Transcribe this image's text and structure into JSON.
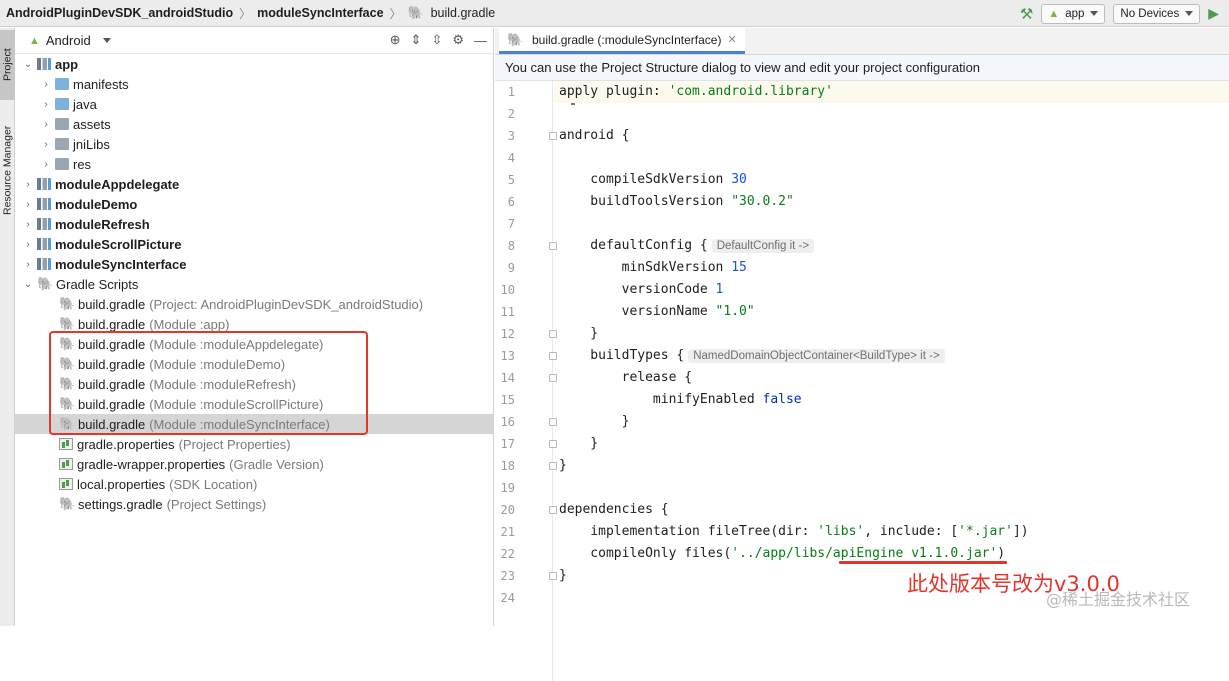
{
  "breadcrumb": {
    "items": [
      "AndroidPluginDevSDK_androidStudio",
      "moduleSyncInterface",
      "build.gradle"
    ]
  },
  "toolbar": {
    "run_config": "app",
    "device": "No Devices"
  },
  "sidebar_tabs": [
    "Project",
    "Resource Manager"
  ],
  "project_panel": {
    "view_mode": "Android",
    "tree": [
      {
        "label": "app",
        "hint": "",
        "bold": true,
        "type": "module",
        "expanded": true
      },
      {
        "label": "manifests",
        "hint": "",
        "type": "folder"
      },
      {
        "label": "java",
        "hint": "",
        "type": "folder"
      },
      {
        "label": "assets",
        "hint": "",
        "type": "folder-grey"
      },
      {
        "label": "jniLibs",
        "hint": "",
        "type": "folder-grey"
      },
      {
        "label": "res",
        "hint": "",
        "type": "folder-grey"
      },
      {
        "label": "moduleAppdelegate",
        "hint": "",
        "bold": true,
        "type": "module"
      },
      {
        "label": "moduleDemo",
        "hint": "",
        "bold": true,
        "type": "module"
      },
      {
        "label": "moduleRefresh",
        "hint": "",
        "bold": true,
        "type": "module"
      },
      {
        "label": "moduleScrollPicture",
        "hint": "",
        "bold": true,
        "type": "module"
      },
      {
        "label": "moduleSyncInterface",
        "hint": "",
        "bold": true,
        "type": "module"
      },
      {
        "label": "Gradle Scripts",
        "hint": "",
        "type": "gradle",
        "expanded": true
      },
      {
        "label": "build.gradle",
        "hint": "(Project: AndroidPluginDevSDK_androidStudio)",
        "type": "gradle"
      },
      {
        "label": "build.gradle",
        "hint": "(Module :app)",
        "type": "gradle"
      },
      {
        "label": "build.gradle",
        "hint": "(Module :moduleAppdelegate)",
        "type": "gradle"
      },
      {
        "label": "build.gradle",
        "hint": "(Module :moduleDemo)",
        "type": "gradle"
      },
      {
        "label": "build.gradle",
        "hint": "(Module :moduleRefresh)",
        "type": "gradle"
      },
      {
        "label": "build.gradle",
        "hint": "(Module :moduleScrollPicture)",
        "type": "gradle"
      },
      {
        "label": "build.gradle",
        "hint": "(Module :moduleSyncInterface)",
        "type": "gradle",
        "selected": true
      },
      {
        "label": "gradle.properties",
        "hint": "(Project Properties)",
        "type": "props"
      },
      {
        "label": "gradle-wrapper.properties",
        "hint": "(Gradle Version)",
        "type": "props"
      },
      {
        "label": "local.properties",
        "hint": "(SDK Location)",
        "type": "props"
      },
      {
        "label": "settings.gradle",
        "hint": "(Project Settings)",
        "type": "gradle"
      }
    ]
  },
  "editor": {
    "tab_title": "build.gradle (:moduleSyncInterface)",
    "banner": "You can use the Project Structure dialog to view and edit your project configuration",
    "line_numbers": [
      "1",
      "2",
      "3",
      "4",
      "5",
      "6",
      "7",
      "8",
      "9",
      "10",
      "11",
      "12",
      "13",
      "14",
      "15",
      "16",
      "17",
      "18",
      "19",
      "20",
      "21",
      "22",
      "23",
      "24"
    ],
    "code": {
      "l1_a": "apply plugin: ",
      "l1_b": "'com.android.library'",
      "l3": "android {",
      "l5_a": "    compileSdkVersion ",
      "l5_b": "30",
      "l6_a": "    buildToolsVersion ",
      "l6_b": "\"30.0.2\"",
      "l8_a": "    defaultConfig {",
      "l8_hint": "DefaultConfig it ->",
      "l9_a": "        minSdkVersion ",
      "l9_b": "15",
      "l10_a": "        versionCode ",
      "l10_b": "1",
      "l11_a": "        versionName ",
      "l11_b": "\"1.0\"",
      "l12": "    }",
      "l13_a": "    buildTypes {",
      "l13_hint": "NamedDomainObjectContainer<BuildType> it ->",
      "l14": "        release {",
      "l15_a": "            minifyEnabled ",
      "l15_b": "false",
      "l16": "        }",
      "l17": "    }",
      "l18": "}",
      "l20": "dependencies {",
      "l21_a": "    implementation fileTree(dir: ",
      "l21_b": "'libs'",
      "l21_c": ", include: [",
      "l21_d": "'*.jar'",
      "l21_e": "])",
      "l22_a": "    compileOnly files(",
      "l22_b": "'../app/libs/apiEngine v1.1.0.jar'",
      "l22_c": ")",
      "l23": "}"
    }
  },
  "annotation": {
    "text": "此处版本号改为v3.0.0",
    "color": "#e3352b"
  },
  "watermark": "@稀土掘金技术社区"
}
